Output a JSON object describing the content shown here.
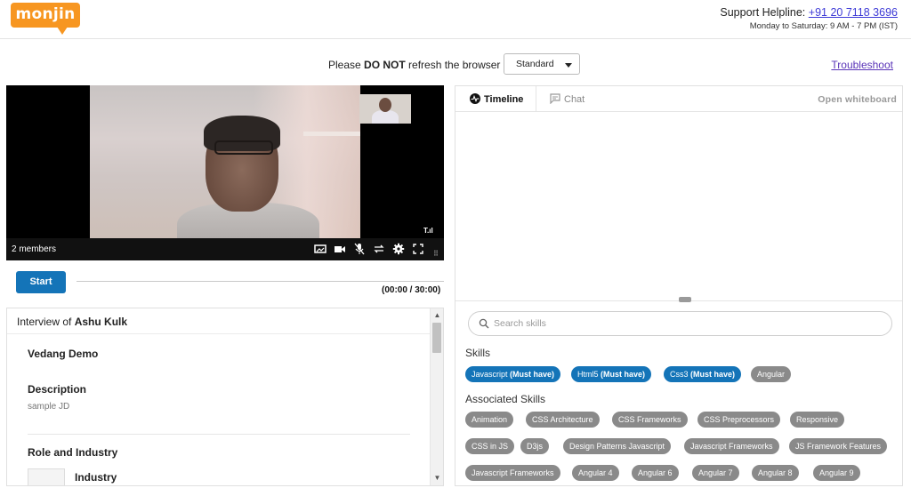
{
  "app": {
    "logo_text": "monjin",
    "brand_color": "#f79621"
  },
  "header": {
    "helpline_label": "Support Helpline:",
    "helpline_number": "+91 20 7118 3696",
    "helpline_hours": "Monday to Saturday: 9 AM - 7 PM (IST)"
  },
  "toolbar": {
    "refresh_pre": "Please ",
    "refresh_bold": "DO NOT",
    "refresh_post": " refresh the browser",
    "quality_selected": "Standard",
    "troubleshoot_label": "Troubleshoot"
  },
  "video": {
    "members_label": "2 members",
    "signal_label": "T.ıl",
    "controls": [
      "screen-share-icon",
      "camera-icon",
      "mic-muted-icon",
      "switch-icon",
      "settings-icon",
      "fullscreen-icon"
    ]
  },
  "session": {
    "start_label": "Start",
    "timer": "(00:00 / 30:00)"
  },
  "interview": {
    "title_pre": "Interview of ",
    "candidate": "Ashu Kulk",
    "company": "Vedang Demo",
    "description_label": "Description",
    "description_value": "sample JD",
    "role_label": "Role and Industry",
    "industry_label": "Industry"
  },
  "right_panel": {
    "tabs": [
      {
        "label": "Timeline",
        "active": true
      },
      {
        "label": "Chat",
        "active": false
      }
    ],
    "whiteboard_label": "Open whiteboard",
    "search_placeholder": "Search skills",
    "skills_title": "Skills",
    "skills": [
      {
        "name": "Javascript",
        "tag": "(Must have)"
      },
      {
        "name": "Html5",
        "tag": "(Must have)"
      },
      {
        "name": "Css3",
        "tag": "(Must have)"
      },
      {
        "name": "Angular",
        "tag": ""
      }
    ],
    "associated_title": "Associated Skills",
    "associated": [
      "Animation",
      "CSS Architecture",
      "CSS Frameworks",
      "CSS Preprocessors",
      "Responsive",
      "CSS in JS",
      "D3js",
      "Design Patterns Javascript",
      "Javascript Frameworks",
      "JS Framework Features",
      "Javascript Frameworks",
      "Angular 4",
      "Angular 6",
      "Angular 7",
      "Angular 8",
      "Angular 9"
    ],
    "colors": {
      "must_have": "#1474b8",
      "skill": "#8a8a8a"
    }
  }
}
